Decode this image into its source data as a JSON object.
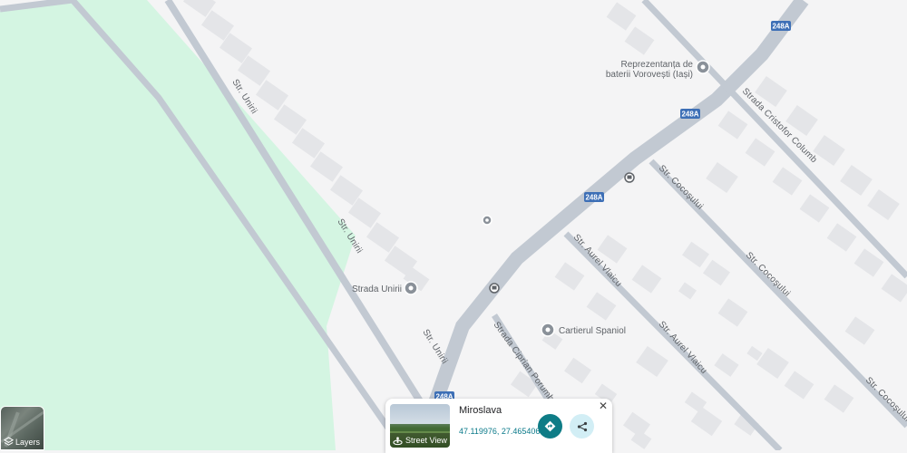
{
  "map": {
    "roads": {
      "unirii": "Str. Unirii",
      "cristofor_columb": "Strada Cristofor Columb",
      "cocosului": "Str. Cocoșului",
      "aurel_vlaicu": "Str. Aurel Vlaicu",
      "ciprian_porumbescu": "Strada Ciprian Porumbescu",
      "route_number": "248A"
    },
    "pois": {
      "battery_shop": [
        "Reprezentanța de",
        "baterii Vorovești (Iași)"
      ],
      "strada_unirii": "Strada Unirii",
      "cartierul_spaniol": "Cartierul Spaniol"
    },
    "colors": {
      "park": "#d4f5e2",
      "road": "#c2c9d2",
      "shield": "#3d6fb6",
      "block": "#e4e5e8"
    }
  },
  "layers": {
    "label": "Layers"
  },
  "card": {
    "place_name": "Miroslava",
    "coordinates": "47.119976, 27.465406",
    "street_view_label": "Street View",
    "close_symbol": "✕"
  }
}
